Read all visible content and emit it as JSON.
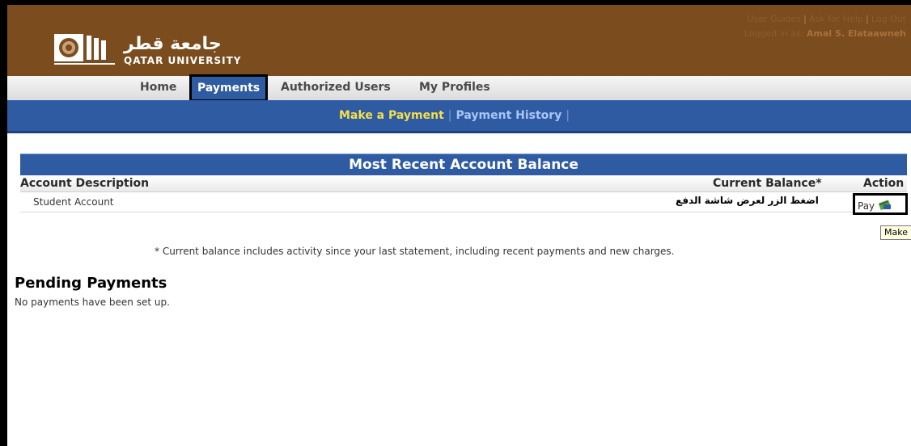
{
  "header": {
    "logo_arabic": "جامعة قطر",
    "logo_english": "QATAR UNIVERSITY",
    "links": [
      "User Guides",
      "Ask for Help",
      "Log Out"
    ],
    "logged_in_label": "Logged in as:",
    "user_name": "Amal S. Elataawneh"
  },
  "nav": {
    "items": [
      "Home",
      "Payments",
      "Authorized Users",
      "My Profiles"
    ],
    "active": "Payments"
  },
  "subnav": {
    "make_payment": "Make a Payment",
    "payment_history": "Payment History",
    "separator": "|"
  },
  "balance": {
    "title": "Most Recent Account Balance",
    "columns": [
      "Account Description",
      "Current Balance*",
      "Action"
    ],
    "row": {
      "description": "Student Account",
      "instruction_arabic": "اضغط الزر لعرض شاشة الدفع",
      "action_label": "Pay"
    },
    "tooltip": "Make a"
  },
  "footnote": "* Current balance includes activity since your last statement, including recent payments and new charges.",
  "pending": {
    "title": "Pending Payments",
    "note": "No payments have been set up."
  },
  "colors": {
    "header_brown": "#7a4c1e",
    "nav_blue": "#2f5ba3",
    "active_yellow": "#f4e04a"
  }
}
